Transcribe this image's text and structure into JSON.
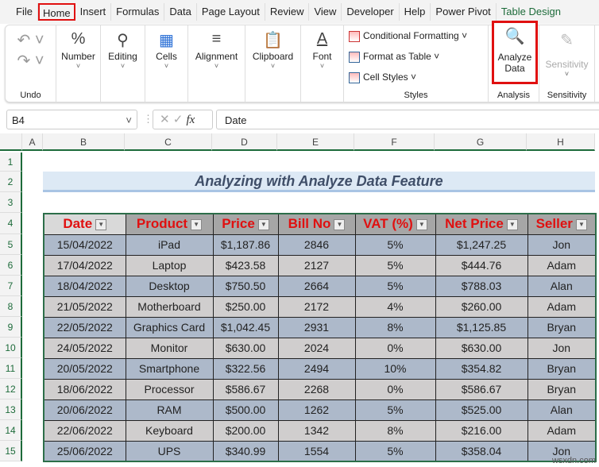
{
  "tabs": [
    "File",
    "Home",
    "Insert",
    "Formulas",
    "Data",
    "Page Layout",
    "Review",
    "View",
    "Developer",
    "Help",
    "Power Pivot",
    "Table Design"
  ],
  "ribbon": {
    "undo": "Undo",
    "number": "Number",
    "editing": "Editing",
    "cells": "Cells",
    "alignment": "Alignment",
    "clipboard": "Clipboard",
    "font": "Font",
    "cond_fmt": "Conditional Formatting",
    "fmt_table": "Format as Table",
    "cell_styles": "Cell Styles",
    "styles": "Styles",
    "analyze1": "Analyze",
    "analyze2": "Data",
    "analysis": "Analysis",
    "sensitivity": "Sensitivity",
    "sensitivity_group": "Sensitivity"
  },
  "formula_bar": {
    "name_box": "B4",
    "fx": "fx",
    "value": "Date"
  },
  "columns": [
    "A",
    "B",
    "C",
    "D",
    "E",
    "F",
    "G",
    "H"
  ],
  "rows": [
    "1",
    "2",
    "3",
    "4",
    "5",
    "6",
    "7",
    "8",
    "9",
    "10",
    "11",
    "12",
    "13",
    "14",
    "15"
  ],
  "title": "Analyzing with Analyze Data Feature",
  "table": {
    "headers": [
      "Date",
      "Product",
      "Price",
      "Bill No",
      "VAT (%)",
      "Net Price",
      "Seller"
    ],
    "rows": [
      [
        "15/04/2022",
        "iPad",
        "$1,187.86",
        "2846",
        "5%",
        "$1,247.25",
        "Jon"
      ],
      [
        "17/04/2022",
        "Laptop",
        "$423.58",
        "2127",
        "5%",
        "$444.76",
        "Adam"
      ],
      [
        "18/04/2022",
        "Desktop",
        "$750.50",
        "2664",
        "5%",
        "$788.03",
        "Alan"
      ],
      [
        "21/05/2022",
        "Motherboard",
        "$250.00",
        "2172",
        "4%",
        "$260.00",
        "Adam"
      ],
      [
        "22/05/2022",
        "Graphics Card",
        "$1,042.45",
        "2931",
        "8%",
        "$1,125.85",
        "Bryan"
      ],
      [
        "24/05/2022",
        "Monitor",
        "$630.00",
        "2024",
        "0%",
        "$630.00",
        "Jon"
      ],
      [
        "20/05/2022",
        "Smartphone",
        "$322.56",
        "2494",
        "10%",
        "$354.82",
        "Bryan"
      ],
      [
        "18/06/2022",
        "Processor",
        "$586.67",
        "2268",
        "0%",
        "$586.67",
        "Bryan"
      ],
      [
        "20/06/2022",
        "RAM",
        "$500.00",
        "1262",
        "5%",
        "$525.00",
        "Alan"
      ],
      [
        "22/06/2022",
        "Keyboard",
        "$200.00",
        "1342",
        "8%",
        "$216.00",
        "Adam"
      ],
      [
        "25/06/2022",
        "UPS",
        "$340.99",
        "1554",
        "5%",
        "$358.04",
        "Jon"
      ]
    ]
  },
  "watermark": "wsxdn.com"
}
